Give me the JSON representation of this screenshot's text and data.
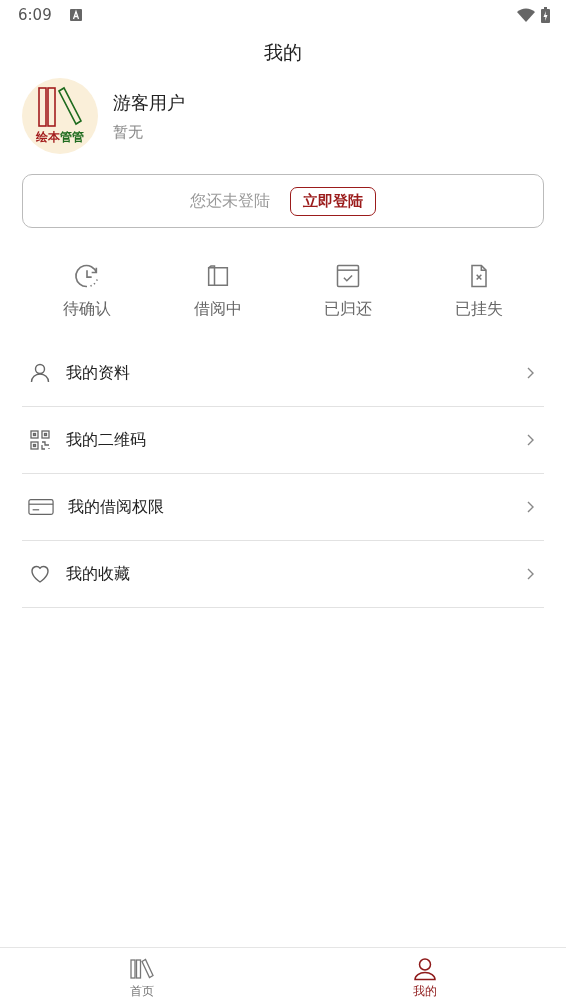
{
  "status_bar": {
    "time": "6:09"
  },
  "header": {
    "title": "我的"
  },
  "profile": {
    "logo_parts": [
      {
        "text": "绘本",
        "color": "#a31d1d"
      },
      {
        "text": "管管",
        "color": "#1e6b1e"
      }
    ],
    "name": "游客用户",
    "subtitle": "暂无"
  },
  "login_banner": {
    "message": "您还未登陆",
    "button": "立即登陆"
  },
  "order_status": [
    {
      "kind": "pending",
      "label": "待确认"
    },
    {
      "kind": "borrowing",
      "label": "借阅中"
    },
    {
      "kind": "returned",
      "label": "已归还"
    },
    {
      "kind": "lost",
      "label": "已挂失"
    }
  ],
  "menu": [
    {
      "kind": "profile",
      "label": "我的资料"
    },
    {
      "kind": "qrcode",
      "label": "我的二维码"
    },
    {
      "kind": "card",
      "label": "我的借阅权限"
    },
    {
      "kind": "favorite",
      "label": "我的收藏"
    }
  ],
  "bottom_nav": [
    {
      "kind": "home",
      "label": "首页",
      "selected": false
    },
    {
      "kind": "mine",
      "label": "我的",
      "selected": true
    }
  ]
}
